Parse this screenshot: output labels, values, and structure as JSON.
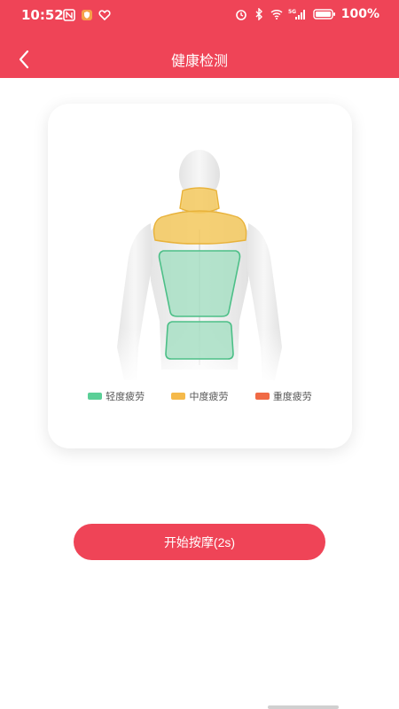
{
  "status_bar": {
    "time": "10:52",
    "battery": "100%"
  },
  "header": {
    "title": "健康检测"
  },
  "legend": [
    {
      "label": "轻度疲劳",
      "color": "#5bcf97"
    },
    {
      "label": "中度疲劳",
      "color": "#f5b94a"
    },
    {
      "label": "重度疲劳",
      "color": "#f06a45"
    }
  ],
  "zones": {
    "neck": "moderate",
    "shoulders": "moderate",
    "upper_back": "mild",
    "lower_back": "mild"
  },
  "actions": {
    "start_label": "开始按摩(2s)"
  },
  "icons": {
    "back": "chevron-left-icon"
  }
}
